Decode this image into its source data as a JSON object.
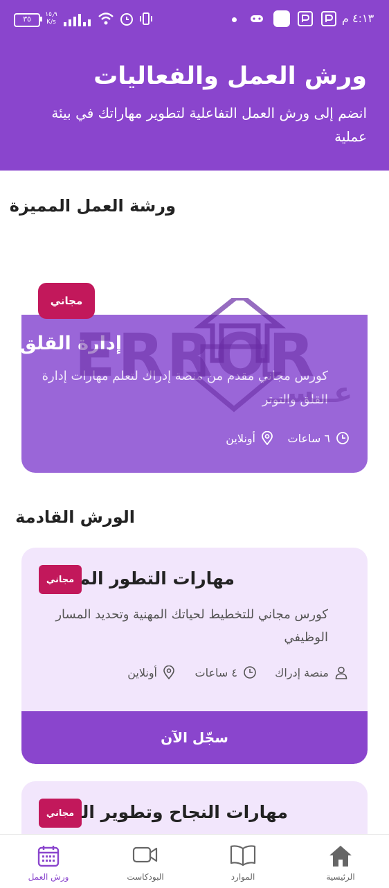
{
  "statusbar": {
    "time": "٤:١٣ م",
    "battery": "٣٥",
    "net_speed_value": "١٥٫٩",
    "net_speed_unit": "K/s"
  },
  "header": {
    "title": "ورش العمل والفعاليات",
    "subtitle": "انضم إلى ورش العمل التفاعلية لتطوير مهاراتك في بيئة عملية"
  },
  "featured_section": {
    "title": "ورشة العمل المميزة"
  },
  "featured": {
    "badge": "مجاني",
    "title": "إدارة القلق",
    "description": "كورس مجاني مقدم من منصة إدراك لتعلم مهارات إدارة القلق والتوتر",
    "duration": "٦ ساعات",
    "mode": "أونلاين"
  },
  "watermark": {
    "main": "ERROR",
    "sub": "عــســ"
  },
  "upcoming_section": {
    "title": "الورش القادمة"
  },
  "workshops": [
    {
      "title": "مهارات التطور المهني",
      "badge": "مجاني",
      "description": "كورس مجاني للتخطيط لحياتك المهنية وتحديد المسار الوظيفي",
      "provider": "منصة إدراك",
      "duration": "٤ ساعات",
      "mode": "أونلاين",
      "register": "سجّل الآن"
    },
    {
      "title": "مهارات النجاح وتطوير الذات",
      "badge": "مجاني"
    }
  ],
  "nav": {
    "home": "الرئيسية",
    "resources": "الموارد",
    "podcast": "البودكاست",
    "workshops": "ورش العمل"
  },
  "colors": {
    "primary": "#8a45cd",
    "featured_card": "#9a66d8",
    "badge": "#c2185b",
    "card_bg": "#f2e6fc"
  }
}
